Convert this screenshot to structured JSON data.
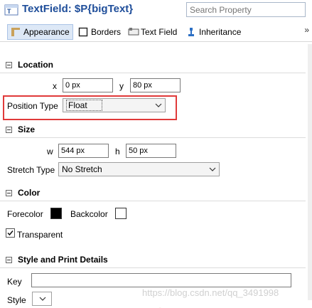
{
  "header": {
    "title": "TextField: $P{bigText}",
    "search_placeholder": "Search Property"
  },
  "tabs": [
    {
      "label": "Appearance",
      "icon": "appearance-icon"
    },
    {
      "label": "Borders",
      "icon": "borders-icon"
    },
    {
      "label": "Text Field",
      "icon": "text-field-icon"
    },
    {
      "label": "Inheritance",
      "icon": "inheritance-icon"
    }
  ],
  "tab_more": "»",
  "location": {
    "title": "Location",
    "x_label": "x",
    "x_value": "0 px",
    "y_label": "y",
    "y_value": "80 px",
    "position_type_label": "Position Type",
    "position_type_value": "Float"
  },
  "size": {
    "title": "Size",
    "w_label": "w",
    "w_value": "544 px",
    "h_label": "h",
    "h_value": "50 px",
    "stretch_type_label": "Stretch Type",
    "stretch_type_value": "No Stretch"
  },
  "color": {
    "title": "Color",
    "forecolor_label": "Forecolor",
    "forecolor_value": "#000000",
    "backcolor_label": "Backcolor",
    "backcolor_value": "#ffffff",
    "transparent_label": "Transparent",
    "transparent_checked": true
  },
  "style_print": {
    "title": "Style and Print Details",
    "key_label": "Key",
    "key_value": "",
    "style_label": "Style"
  },
  "watermark": "https://blog.csdn.net/qq_3491998"
}
